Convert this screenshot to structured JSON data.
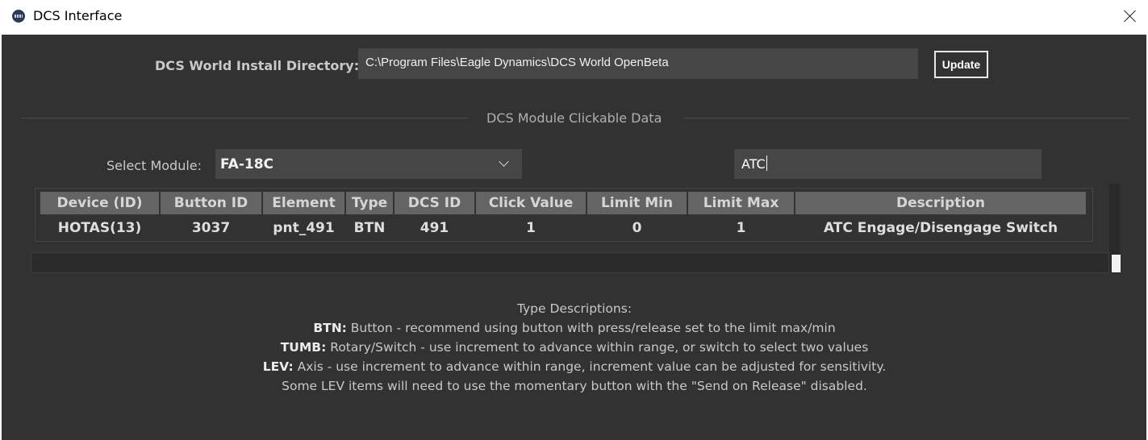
{
  "window": {
    "title": "DCS Interface",
    "icon": "app-icon"
  },
  "install": {
    "label": "DCS World Install Directory:",
    "path": "C:\\Program Files\\Eagle Dynamics\\DCS World OpenBeta",
    "update_label": "Update"
  },
  "section": {
    "title": "DCS Module Clickable Data"
  },
  "module": {
    "label": "Select Module:",
    "selected": "FA-18C"
  },
  "search": {
    "value": "ATC"
  },
  "table": {
    "headers": [
      "Device (ID)",
      "Button ID",
      "Element",
      "Type",
      "DCS ID",
      "Click Value",
      "Limit Min",
      "Limit Max",
      "Description"
    ],
    "rows": [
      [
        "HOTAS(13)",
        "3037",
        "pnt_491",
        "BTN",
        "491",
        "1",
        "0",
        "1",
        "ATC Engage/Disengage Switch"
      ]
    ]
  },
  "descriptions": {
    "heading": "Type Descriptions:",
    "items": [
      {
        "key": "BTN:",
        "text": " Button - recommend using button with press/release set to the limit max/min"
      },
      {
        "key": "TUMB:",
        "text": " Rotary/Switch - use increment to advance within range, or switch to select two values"
      },
      {
        "key": "LEV:",
        "text": " Axis - use increment to advance within range, increment value can be adjusted for sensitivity."
      }
    ],
    "note": "Some LEV items will need to use the momentary button with the \"Send on Release\" disabled."
  },
  "colors": {
    "background": "#323232",
    "input": "#464646",
    "header": "#646464"
  }
}
